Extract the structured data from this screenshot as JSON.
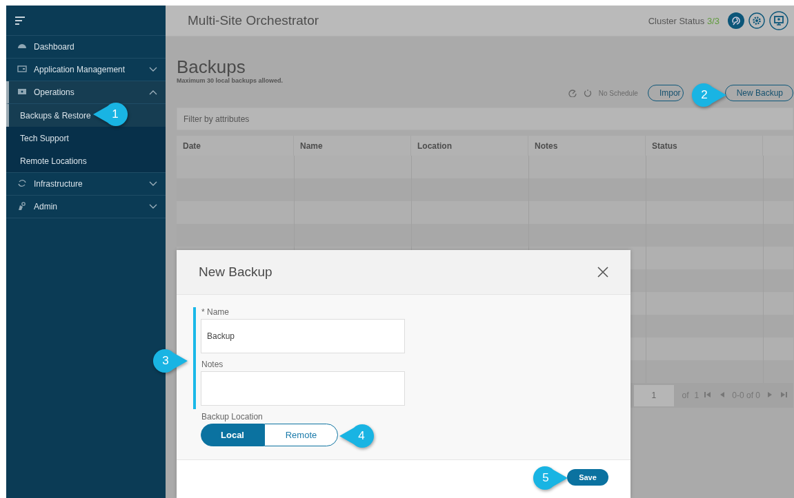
{
  "header": {
    "title": "Multi-Site Orchestrator",
    "cluster_status_label": "Cluster Status",
    "cluster_status_value": "3/3"
  },
  "sidebar": {
    "items": [
      {
        "label": "Dashboard",
        "selected": false
      },
      {
        "label": "Application Management",
        "selected": false,
        "expanded": false
      },
      {
        "label": "Operations",
        "selected": false,
        "expanded": true,
        "children": [
          {
            "label": "Backups & Restore",
            "selected": true
          },
          {
            "label": "Tech Support",
            "selected": false
          },
          {
            "label": "Remote Locations",
            "selected": false
          }
        ]
      },
      {
        "label": "Infrastructure",
        "selected": false,
        "expanded": false
      },
      {
        "label": "Admin",
        "selected": false,
        "expanded": false
      }
    ]
  },
  "page": {
    "title": "Backups",
    "subtitle": "Maximum 30 local backups allowed.",
    "schedule": "No Schedule",
    "buttons": [
      "Impor",
      "New Backup"
    ],
    "filter": {
      "placeholder": "Filter by attributes"
    },
    "table": {
      "columns": [
        "Date",
        "Name",
        "Location",
        "Notes",
        "Status"
      ]
    },
    "pagination": {
      "page": "1",
      "of": "of",
      "total": "1",
      "range": "0-0 of 0"
    }
  },
  "dialog": {
    "title": "New Backup",
    "fields": [
      {
        "label": "* Name",
        "value": "Backup"
      },
      {
        "label": "Notes"
      }
    ],
    "location": {
      "label": "Backup Location",
      "options": [
        {
          "label": "Local",
          "selected": true
        },
        {
          "label": "Remote",
          "selected": false
        }
      ]
    },
    "save": "Save"
  },
  "callouts": [
    "1",
    "2",
    "3",
    "4",
    "5"
  ]
}
